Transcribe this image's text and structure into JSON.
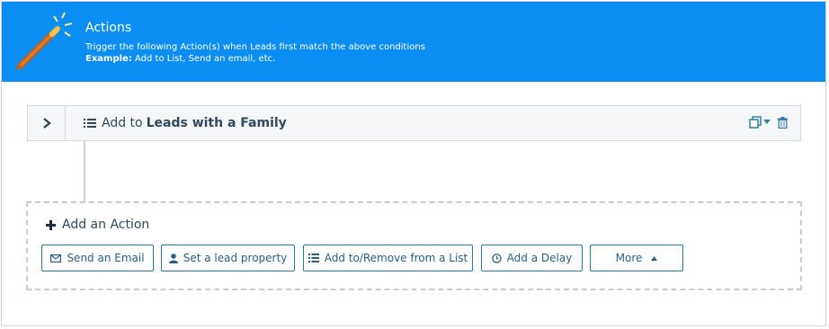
{
  "header": {
    "title": "Actions",
    "line1": "Trigger the following Action(s) when Leads first match the above conditions",
    "example_label": "Example:",
    "example_text": " Add to List, Send an email, etc."
  },
  "action_row": {
    "prefix": "Add to",
    "list_name": "Leads with a Family",
    "icons": [
      "chevron-right-icon",
      "list-icon",
      "clone-icon",
      "caret-down-icon",
      "trash-icon"
    ]
  },
  "add_action": {
    "title": "Add an Action",
    "buttons": {
      "send_email": "Send an Email",
      "set_property": "Set a lead property",
      "add_remove_list": "Add to/Remove from a List",
      "add_delay": "Add a Delay",
      "more": "More"
    }
  },
  "colors": {
    "header_bg": "#0a8ef4",
    "button_border": "#2c7a93",
    "text_dark": "#33475b"
  }
}
